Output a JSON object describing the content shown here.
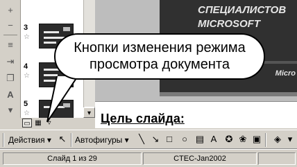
{
  "left_toolbar": {
    "icons": [
      "plus-icon",
      "minus-icon",
      "align-lines-icon",
      "indent-icon",
      "copy-icon",
      "text-size-icon",
      "font-color-icon"
    ]
  },
  "slides_pane": {
    "thumbnails": [
      {
        "number": "3",
        "star": "☆"
      },
      {
        "number": "4",
        "star": "☆"
      },
      {
        "number": "5",
        "star": "☆"
      }
    ]
  },
  "slide": {
    "title": "СПЕЦИАЛИСТОВ MICROSOFT",
    "logo_text": "Micro"
  },
  "notes": {
    "text": "Цель слайда:"
  },
  "callout": {
    "text_line1": "Кнопки изменения режима",
    "text_line2": "просмотра документа"
  },
  "drawing_toolbar": {
    "actions_label": "Действия",
    "autoshapes_label": "Автофигуры"
  },
  "status_bar": {
    "slide_counter": "Слайд 1 из 29",
    "design_name": "CTEC-Jan2002"
  }
}
